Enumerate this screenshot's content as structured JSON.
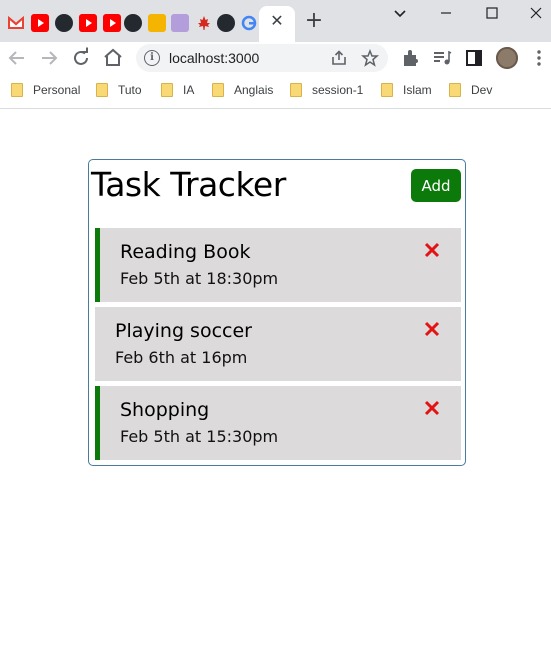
{
  "browser": {
    "tab_close_glyph": "✕",
    "new_tab_glyph": "+",
    "address": "localhost:3000",
    "tab_icons": [
      "gmail-icon",
      "youtube-icon",
      "github-icon",
      "youtube-icon",
      "youtube-icon",
      "github-icon",
      "app-icon",
      "app-icon",
      "canada-icon",
      "github-icon",
      "google-icon"
    ],
    "bookmarks": [
      "Personal",
      "Tuto",
      "IA",
      "Anglais",
      "session-1",
      "Islam",
      "Dev"
    ]
  },
  "app": {
    "title": "Task Tracker",
    "add_label": "Add",
    "accent": "#0b7a0b",
    "delete_color": "#e41313",
    "tasks": [
      {
        "text": "Reading Book",
        "day": "Feb 5th at 18:30pm",
        "reminder": true
      },
      {
        "text": "Playing soccer",
        "day": "Feb 6th at 16pm",
        "reminder": false
      },
      {
        "text": "Shopping",
        "day": "Feb 5th at 15:30pm",
        "reminder": true
      }
    ]
  }
}
